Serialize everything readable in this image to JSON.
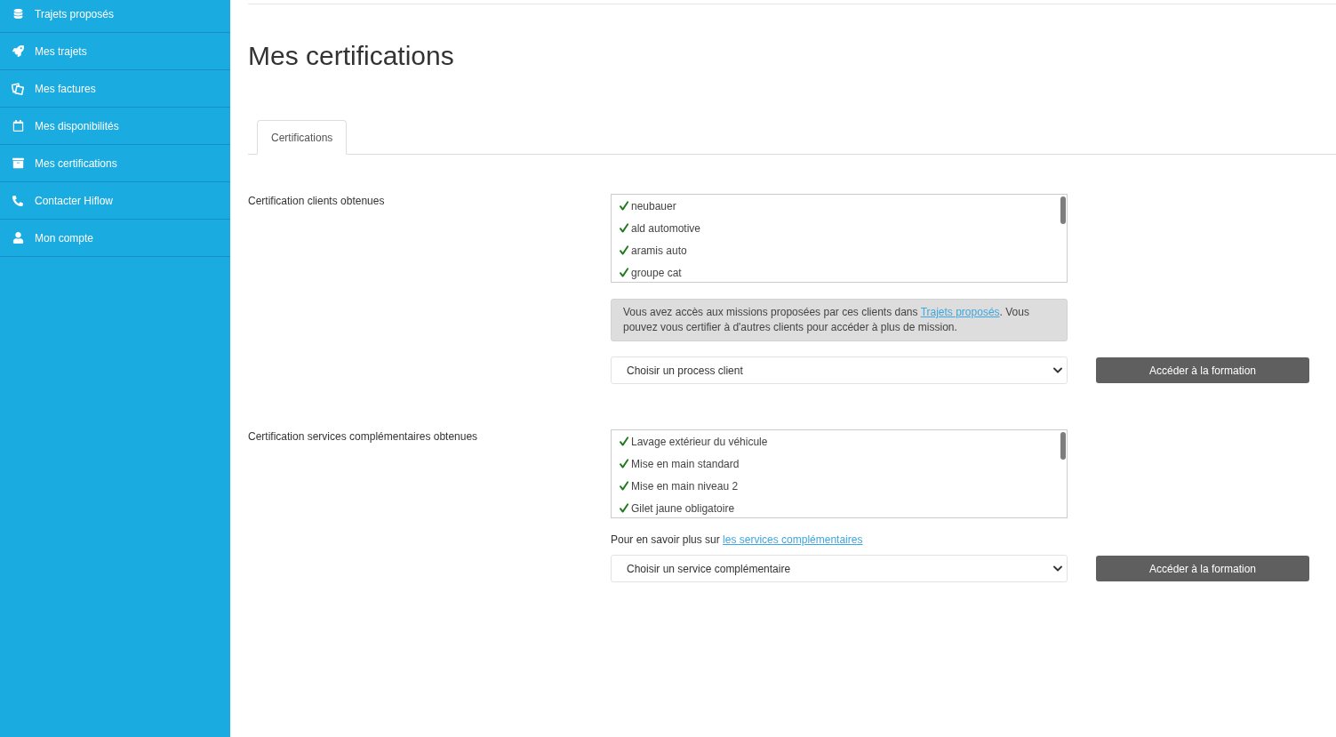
{
  "sidebar": {
    "items": [
      {
        "label": "Trajets proposés",
        "selected": false
      },
      {
        "label": "Mes trajets",
        "selected": false
      },
      {
        "label": "Mes factures",
        "selected": false
      },
      {
        "label": "Mes disponibilités",
        "selected": false
      },
      {
        "label": "Mes certifications",
        "selected": false
      },
      {
        "label": "Contacter Hiflow",
        "selected": false
      },
      {
        "label": "Mon compte",
        "selected": false
      }
    ]
  },
  "page_title": "Mes certifications",
  "tabs": [
    {
      "label": "Certifications",
      "selected": true
    }
  ],
  "sections": [
    {
      "label": "Certification clients obtenues",
      "certifications": [
        {
          "name": "neubauer",
          "checked": true
        },
        {
          "name": "ald automotive",
          "checked": true
        },
        {
          "name": "aramis auto",
          "checked": true
        },
        {
          "name": "groupe cat",
          "checked": true
        }
      ],
      "note": {
        "kind": "alert",
        "text": "Vous avez accès aux missions proposées par ces clients dans ",
        "link": "Trajets proposés",
        "after": ". Vous pouvez vous certifier à d'autres clients pour accéder à plus de mission."
      },
      "select": {
        "value": "Choisir un process client"
      },
      "button": "Accéder à la formation"
    },
    {
      "label": "Certification services complémentaires obtenues",
      "certifications": [
        {
          "name": "Lavage extérieur du véhicule",
          "checked": true
        },
        {
          "name": "Mise en main standard",
          "checked": true
        },
        {
          "name": "Mise en main niveau 2",
          "checked": true
        },
        {
          "name": "Gilet jaune obligatoire",
          "checked": true
        }
      ],
      "note": {
        "kind": "plain",
        "text": "Pour en savoir plus sur ",
        "link": "les services complémentaires"
      },
      "select": {
        "value": "Choisir un service complémentaire"
      },
      "button": "Accéder à la formation"
    }
  ]
}
